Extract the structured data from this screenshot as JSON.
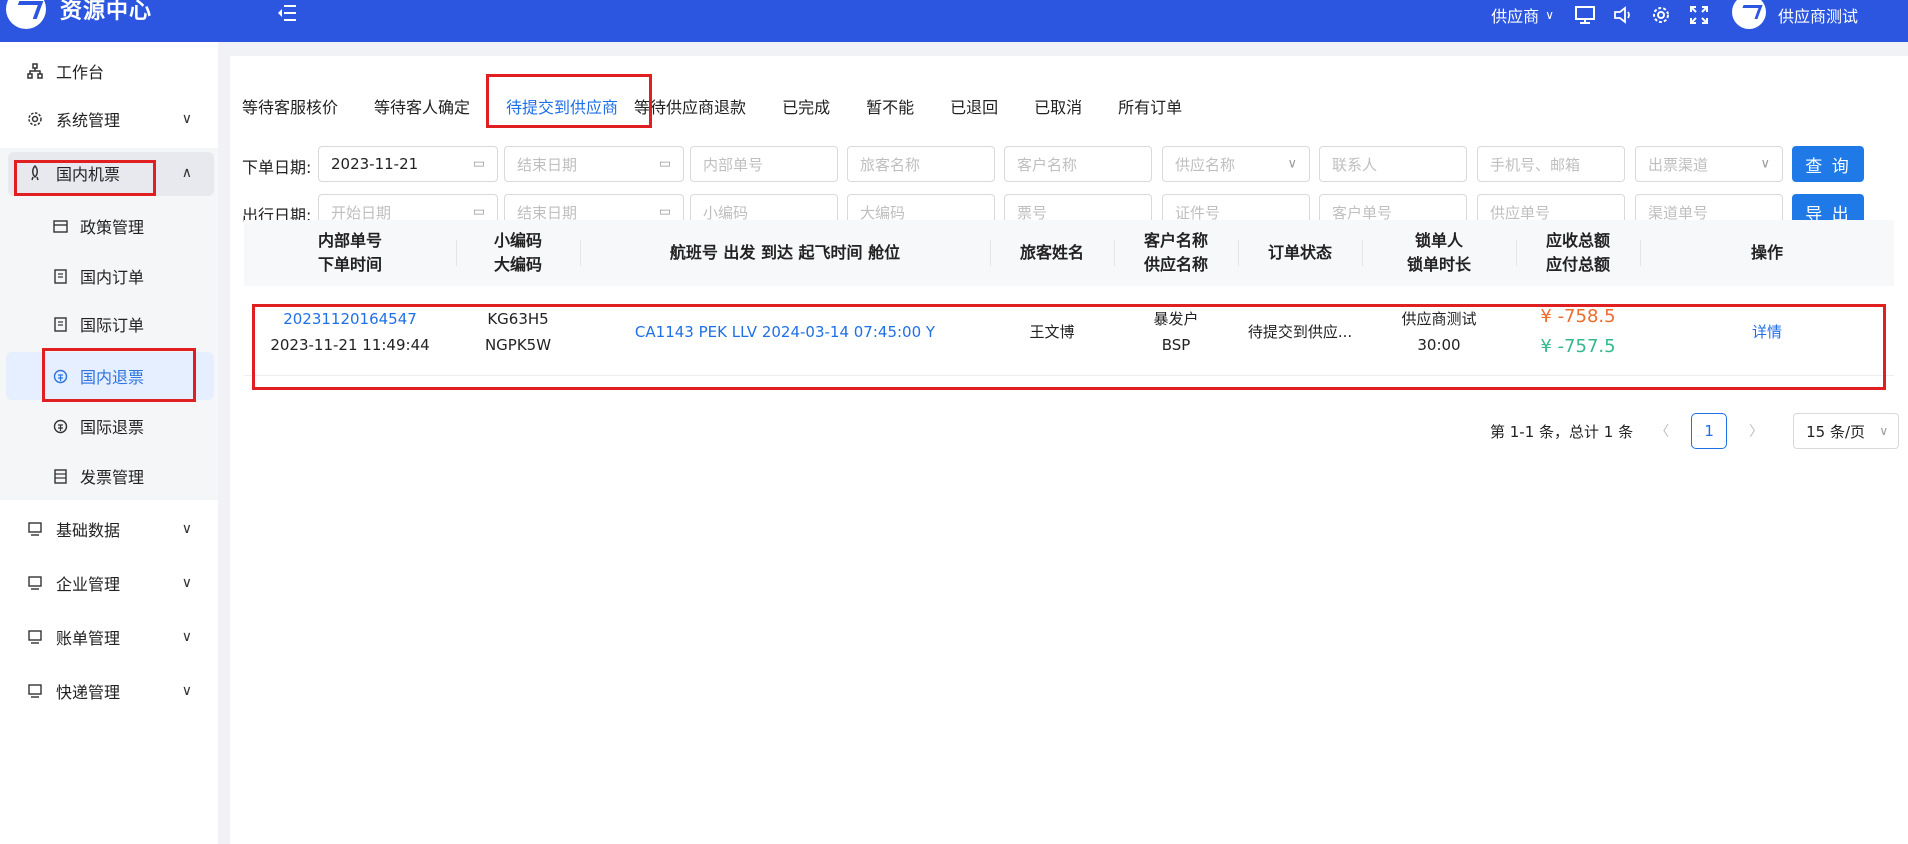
{
  "app": {
    "title": "资源中心",
    "role_selector": "供应商",
    "username": "供应商测试"
  },
  "sidebar": {
    "items": [
      {
        "label": "工作台",
        "icon": "sitemap-icon"
      },
      {
        "label": "系统管理",
        "icon": "gear-icon"
      },
      {
        "label": "国内机票",
        "icon": "rocket-icon"
      },
      {
        "label": "基础数据",
        "icon": "monitor-icon"
      },
      {
        "label": "企业管理",
        "icon": "monitor-icon"
      },
      {
        "label": "账单管理",
        "icon": "monitor-icon"
      },
      {
        "label": "快递管理",
        "icon": "monitor-icon"
      }
    ],
    "sub_items": [
      {
        "label": "政策管理",
        "icon": "card-icon"
      },
      {
        "label": "国内订单",
        "icon": "doc-icon"
      },
      {
        "label": "国际订单",
        "icon": "doc-icon"
      },
      {
        "label": "国内退票",
        "icon": "refund-icon"
      },
      {
        "label": "国际退票",
        "icon": "refund-icon"
      },
      {
        "label": "发票管理",
        "icon": "list-icon"
      }
    ]
  },
  "tabs": [
    "等待客服核价",
    "等待客人确定",
    "待提交到供应商",
    "等待供应商退款",
    "已完成",
    "暂不能",
    "已退回",
    "已取消",
    "所有订单"
  ],
  "filters": {
    "order_date_label": "下单日期:",
    "travel_date_label": "出行日期:",
    "order_start_value": "2023-11-21",
    "order_end_placeholder": "结束日期",
    "travel_start_placeholder": "开始日期",
    "travel_end_placeholder": "结束日期",
    "row1": [
      "内部单号",
      "旅客名称",
      "客户名称",
      "供应名称",
      "联系人",
      "手机号、邮箱",
      "出票渠道"
    ],
    "row2": [
      "小编码",
      "大编码",
      "票号",
      "证件号",
      "客户单号",
      "供应单号",
      "渠道单号"
    ],
    "query_button": "查 询",
    "export_button": "导 出"
  },
  "table": {
    "headers": [
      [
        "内部单号",
        "下单时间"
      ],
      [
        "小编码",
        "大编码"
      ],
      [
        "航班号 出发 到达 起飞时间 舱位"
      ],
      [
        "旅客姓名"
      ],
      [
        "客户名称",
        "供应名称"
      ],
      [
        "订单状态"
      ],
      [
        "锁单人",
        "锁单时长"
      ],
      [
        "应收总额",
        "应付总额"
      ],
      [
        "操作"
      ]
    ],
    "rows": [
      {
        "order_no": "20231120164547",
        "order_time": "2023-11-21 11:49:44",
        "small_code": "KG63H5",
        "big_code": "NGPK5W",
        "flight": "CA1143 PEK LLV 2024-03-14 07:45:00 Y",
        "passenger": "王文博",
        "customer": "暴发户",
        "supplier": "BSP",
        "status": "待提交到供应...",
        "locker": "供应商测试",
        "lock_duration": "30:00",
        "receivable": "¥ -758.5",
        "payable": "¥ -757.5",
        "action": "详情"
      }
    ]
  },
  "pagination": {
    "summary": "第 1-1 条，总计 1 条",
    "current_page": "1",
    "page_size": "15 条/页"
  }
}
